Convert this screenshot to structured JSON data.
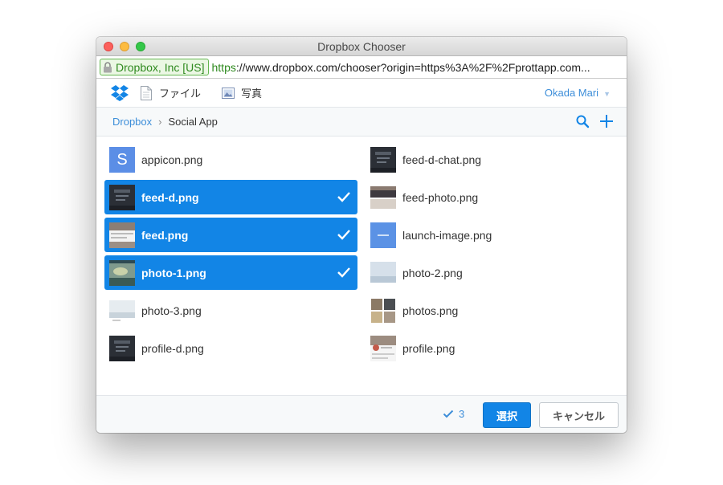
{
  "window": {
    "title": "Dropbox Chooser"
  },
  "urlbar": {
    "ev_label": "Dropbox, Inc [US]",
    "url_scheme": "https",
    "url_rest": "://www.dropbox.com/chooser?origin=https%3A%2F%2Fprottapp.com..."
  },
  "toolbar": {
    "files_tab": "ファイル",
    "photos_tab": "写真",
    "user_name": "Okada Mari"
  },
  "breadcrumb": {
    "root": "Dropbox",
    "separator": "›",
    "current": "Social App"
  },
  "files": [
    {
      "name": "appicon.png",
      "selected": false,
      "thumb": "app-icon",
      "letter": "S"
    },
    {
      "name": "feed-d-chat.png",
      "selected": false,
      "thumb": "dark-phone"
    },
    {
      "name": "feed-d.png",
      "selected": true,
      "thumb": "dark-phone"
    },
    {
      "name": "feed-photo.png",
      "selected": false,
      "thumb": "photo-feed"
    },
    {
      "name": "feed.png",
      "selected": true,
      "thumb": "light-feed"
    },
    {
      "name": "launch-image.png",
      "selected": false,
      "thumb": "blue-launch"
    },
    {
      "name": "photo-1.png",
      "selected": true,
      "thumb": "landscape"
    },
    {
      "name": "photo-2.png",
      "selected": false,
      "thumb": "sky"
    },
    {
      "name": "photo-3.png",
      "selected": false,
      "thumb": "sky-light"
    },
    {
      "name": "photos.png",
      "selected": false,
      "thumb": "grid"
    },
    {
      "name": "profile-d.png",
      "selected": false,
      "thumb": "dark-phone"
    },
    {
      "name": "profile.png",
      "selected": false,
      "thumb": "profile"
    }
  ],
  "footer": {
    "selected_count": "3",
    "choose_label": "選択",
    "cancel_label": "キャンセル"
  },
  "colors": {
    "accent": "#1285e6",
    "link": "#3d8ed9"
  }
}
